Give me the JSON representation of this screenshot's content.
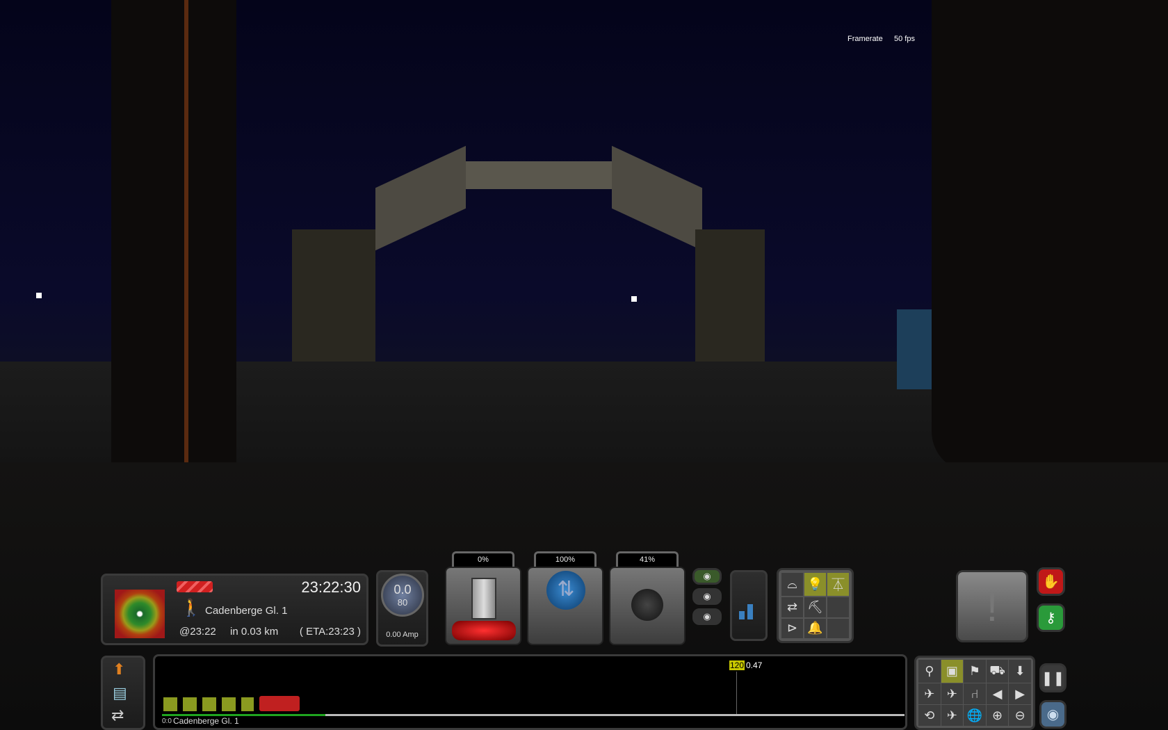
{
  "hud": {
    "framerate_label": "Framerate",
    "framerate_value": "50 fps"
  },
  "info": {
    "time": "23:22:30",
    "station": "Cadenberge Gl. 1",
    "scheduled": "@23:22",
    "distance": "in 0.03 km",
    "eta": "( ETA:23:23 )"
  },
  "gauge": {
    "speed": "0.0",
    "limit": "80",
    "amp": "0.00 Amp"
  },
  "levers": [
    {
      "label": "0%",
      "name": "throttle"
    },
    {
      "label": "100%",
      "name": "reverser"
    },
    {
      "label": "41%",
      "name": "brake"
    }
  ],
  "controls": {
    "cells": [
      "wiper",
      "light",
      "pantograph",
      "coupler",
      "sander",
      "",
      "horn",
      "bell",
      ""
    ],
    "active": [
      "light",
      "pantograph"
    ]
  },
  "track": {
    "signal_speed": "120",
    "signal_distance": "0.47",
    "position": "0:0",
    "station": "Cadenberge Gl. 1",
    "progress": 0.22
  },
  "colors": {
    "accent": "#c8c800",
    "progress": "#1fa51f",
    "alert_red": "#c01818",
    "key_green": "#2a9a3a"
  }
}
